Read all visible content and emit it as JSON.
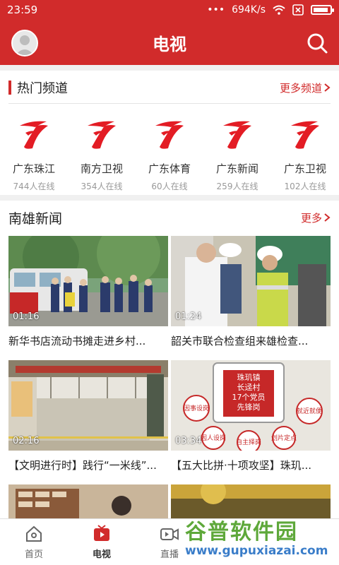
{
  "status": {
    "time": "23:59",
    "speed": "694K/s",
    "dots": "•••"
  },
  "header": {
    "title": "电视"
  },
  "hot_channels": {
    "title": "热门频道",
    "more": "更多频道",
    "items": [
      {
        "name": "广东珠江",
        "count": "744人在线"
      },
      {
        "name": "南方卫视",
        "count": "354人在线"
      },
      {
        "name": "广东体育",
        "count": "60人在线"
      },
      {
        "name": "广东新闻",
        "count": "259人在线"
      },
      {
        "name": "广东卫视",
        "count": "102人在线"
      }
    ]
  },
  "news": {
    "title": "南雄新闻",
    "more": "更多",
    "videos": [
      {
        "duration": "01:16",
        "title": "新华书店流动书摊走进乡村..."
      },
      {
        "duration": "01:24",
        "title": "韶关市联合检查组来雄检查..."
      },
      {
        "duration": "02:16",
        "title": "【文明进行时】践行“一米线”..."
      },
      {
        "duration": "03:34",
        "title": "【五大比拼·十项攻坚】珠玑..."
      }
    ],
    "sign_text": [
      "珠玑镇",
      "长迳村",
      "17个党员",
      "先锋岗"
    ],
    "circle_labels": [
      "因事设岗",
      "因人设岗",
      "自主择岗",
      "划片定点",
      "就近就便"
    ]
  },
  "tabbar": {
    "tabs": [
      {
        "label": "首页"
      },
      {
        "label": "电视"
      },
      {
        "label": "直播"
      }
    ]
  },
  "watermark": {
    "brand": "谷普软件园",
    "url": "www.gupuxiazai.com"
  },
  "colors": {
    "brand_red": "#d12b2b",
    "watermark_green": "#5ea83a",
    "watermark_blue": "#3a7dc9"
  }
}
